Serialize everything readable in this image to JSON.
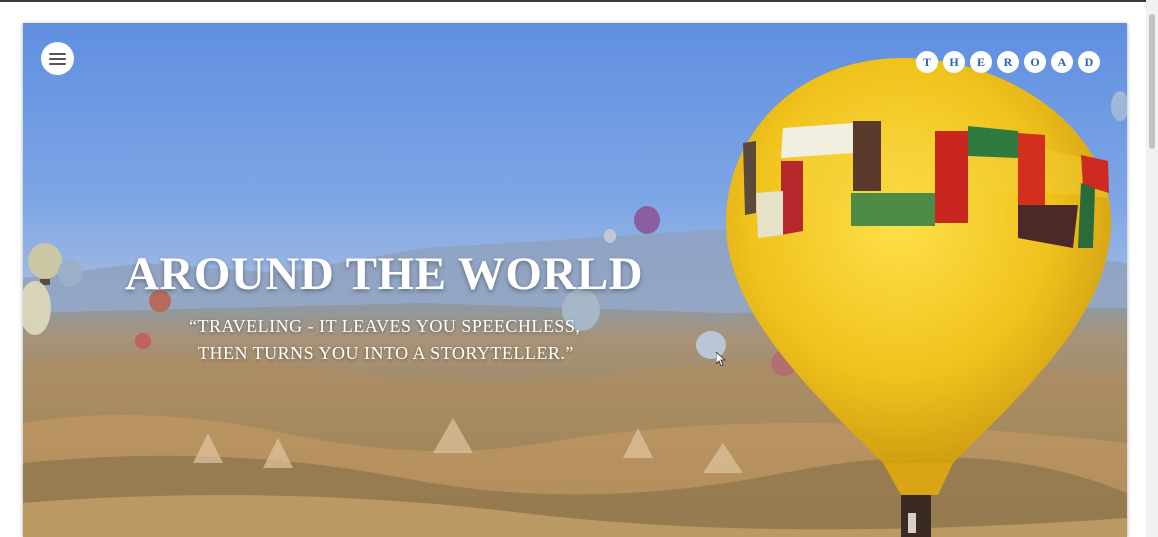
{
  "header": {
    "menu_icon": "hamburger-menu-icon",
    "brand_letters": [
      "T",
      "H",
      "E",
      "R",
      "O",
      "A",
      "D"
    ],
    "brand_color": "#2a63b8"
  },
  "hero": {
    "title": "AROUND THE WORLD",
    "quote_line1": "“TRAVELING - IT LEAVES YOU SPEECHLESS,",
    "quote_line2": "THEN TURNS YOU INTO A STORYTELLER.”",
    "background_image": "hot-air-balloons-over-valley",
    "accent_yellow": "#f2c417"
  }
}
